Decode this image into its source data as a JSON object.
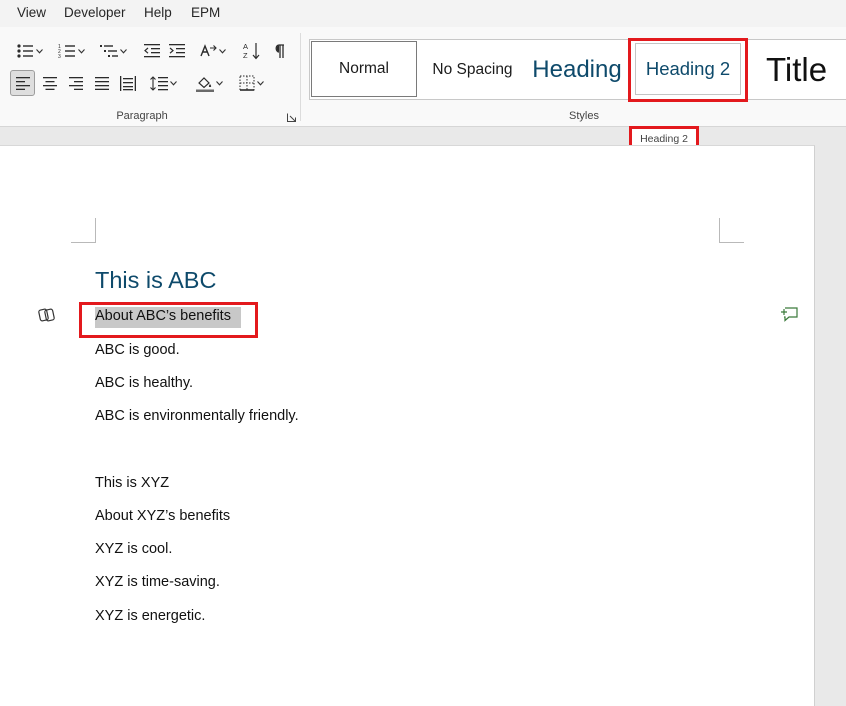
{
  "menu": {
    "items": [
      "View",
      "Developer",
      "Help",
      "EPM"
    ]
  },
  "ribbon": {
    "paragraph_label": "Paragraph",
    "styles_label": "Styles",
    "styles": [
      {
        "label": "Normal"
      },
      {
        "label": "No Spacing"
      },
      {
        "label": "Heading"
      },
      {
        "label": "Heading 2"
      },
      {
        "label": "Title"
      }
    ]
  },
  "tooltip": {
    "text": "Heading 2"
  },
  "document": {
    "heading": "This is ABC",
    "lines": [
      "About ABC’s benefits",
      "ABC is good.",
      "ABC is healthy.",
      "ABC is environmentally friendly.",
      "This is XYZ",
      "About XYZ’s benefits",
      "XYZ is cool.",
      "XYZ is time-saving.",
      "XYZ is energetic."
    ]
  },
  "colors": {
    "heading": "#0e4a6b",
    "highlight": "#e3191d",
    "selection": "#c8c8c8"
  }
}
